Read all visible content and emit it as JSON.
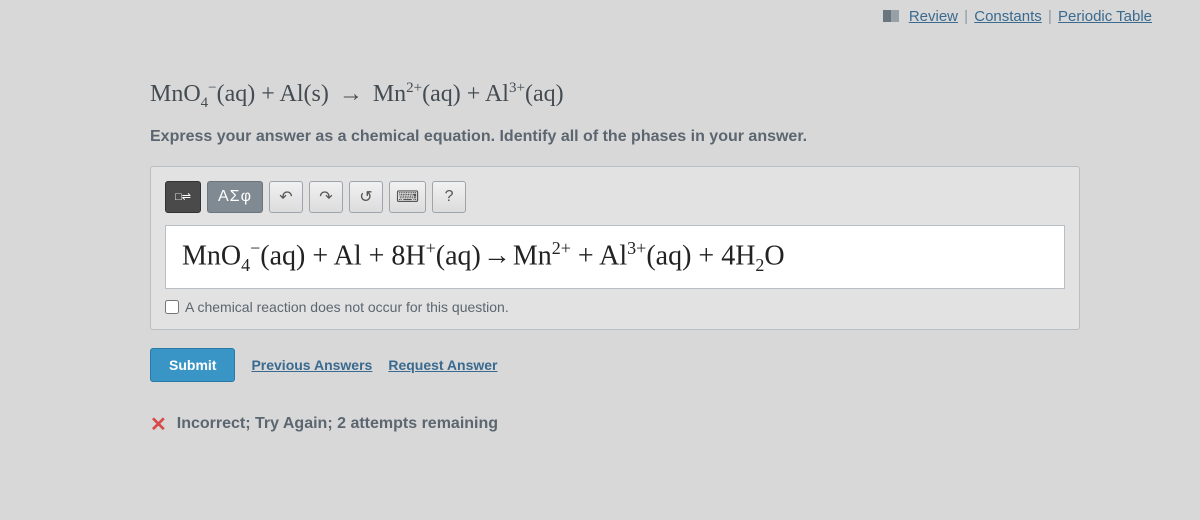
{
  "header": {
    "review": "Review",
    "constants": "Constants",
    "periodic_table": "Periodic Table",
    "sep": "|"
  },
  "prompt": {
    "eq_parts": {
      "p1": "MnO",
      "p1_sub": "4",
      "p1_sup": "−",
      "p2": "(aq) + Al(s) ",
      "arrow": "→",
      "p3": " Mn",
      "p3_sup": "2+",
      "p4": "(aq) + Al",
      "p4_sup": "3+",
      "p5": "(aq)"
    },
    "instruction": "Express your answer as a chemical equation. Identify all of the phases in your answer."
  },
  "toolbar": {
    "templates_label": "□⇌",
    "greek": "ΑΣφ",
    "undo": "↶",
    "redo": "↷",
    "reset": "↺",
    "keyboard": "⌨",
    "help": "?"
  },
  "answer": {
    "eq_parts": {
      "a1": "MnO",
      "a1_sub": "4",
      "a1_sup": "−",
      "a2": "(aq) + Al + 8H",
      "a2_sup": "+",
      "a3": "(aq)",
      "arrow": "→",
      "a4": "Mn",
      "a4_sup": "2+",
      "a5": " + Al",
      "a5_sup": "3+",
      "a6": "(aq) + 4H",
      "a6_sub": "2",
      "a7": "O"
    },
    "checkbox_label": "A chemical reaction does not occur for this question."
  },
  "buttons": {
    "submit": "Submit",
    "previous": "Previous Answers",
    "request": "Request Answer"
  },
  "feedback": {
    "icon": "✕",
    "text": "Incorrect; Try Again; 2 attempts remaining"
  }
}
